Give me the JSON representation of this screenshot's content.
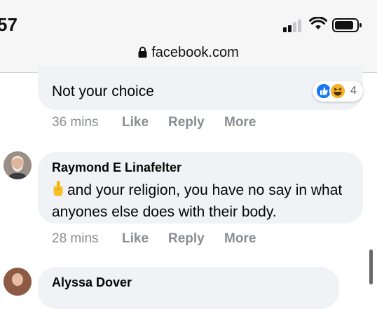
{
  "status_bar": {
    "time": "57",
    "icons": [
      "cellular-signal-icon",
      "wifi-icon",
      "battery-icon"
    ]
  },
  "browser": {
    "url": "facebook.com",
    "lock_icon": "lock-icon"
  },
  "comments": [
    {
      "text": "Not your choice",
      "time": "36 mins",
      "like_label": "Like",
      "reply_label": "Reply",
      "more_label": "More",
      "reactions": {
        "icons": [
          "like-reaction-icon",
          "haha-reaction-icon"
        ],
        "count": "4"
      }
    },
    {
      "author": "Raymond E Linafelter",
      "emoji": "middle-finger-emoji",
      "text": "and your religion, you have no say in what anyones else does with their body.",
      "time": "28 mins",
      "like_label": "Like",
      "reply_label": "Reply",
      "more_label": "More"
    },
    {
      "author": "Alyssa Dover"
    }
  ],
  "colors": {
    "bubble": "#f0f2f5",
    "meta_text": "#8a8d91",
    "like_blue": "#1877f2",
    "haha_yellow": "#f7b125"
  }
}
